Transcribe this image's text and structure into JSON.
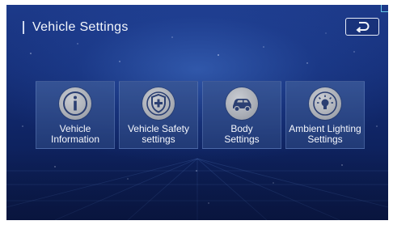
{
  "header": {
    "title": "Vehicle  Settings",
    "back_icon": "return-arrow-icon"
  },
  "tiles": [
    {
      "icon": "info-icon",
      "label": "Vehicle\nInformation"
    },
    {
      "icon": "shield-plus-icon",
      "label": "Vehicle  Safety\nsettings"
    },
    {
      "icon": "car-body-icon",
      "label": "Body\nSettings"
    },
    {
      "icon": "ambient-light-bulb-icon",
      "label": "Ambient  Lighting\nSettings"
    }
  ],
  "colors": {
    "background_top": "#1d3a8a",
    "background_bottom": "#0a1a4a",
    "tile": "#37558f",
    "icon_disc": "#a9adb5",
    "icon_glyph": "#2b3f72",
    "accent": "#66c8e8"
  }
}
